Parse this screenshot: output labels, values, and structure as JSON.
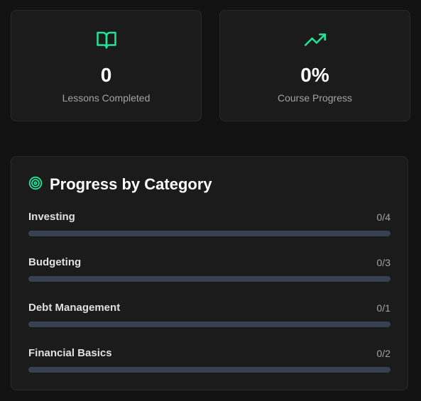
{
  "colors": {
    "accent": "#22e39a",
    "background": "#121212",
    "card": "#1b1b1b",
    "track": "#374151"
  },
  "stats": {
    "lessons": {
      "icon": "book-open-icon",
      "value": "0",
      "label": "Lessons Completed"
    },
    "progress": {
      "icon": "trending-up-icon",
      "value": "0%",
      "label": "Course Progress"
    }
  },
  "category_panel": {
    "icon": "target-icon",
    "title": "Progress by Category",
    "categories": [
      {
        "name": "Investing",
        "count": "0/4",
        "completed": 0,
        "total": 4
      },
      {
        "name": "Budgeting",
        "count": "0/3",
        "completed": 0,
        "total": 3
      },
      {
        "name": "Debt Management",
        "count": "0/1",
        "completed": 0,
        "total": 1
      },
      {
        "name": "Financial Basics",
        "count": "0/2",
        "completed": 0,
        "total": 2
      }
    ]
  }
}
